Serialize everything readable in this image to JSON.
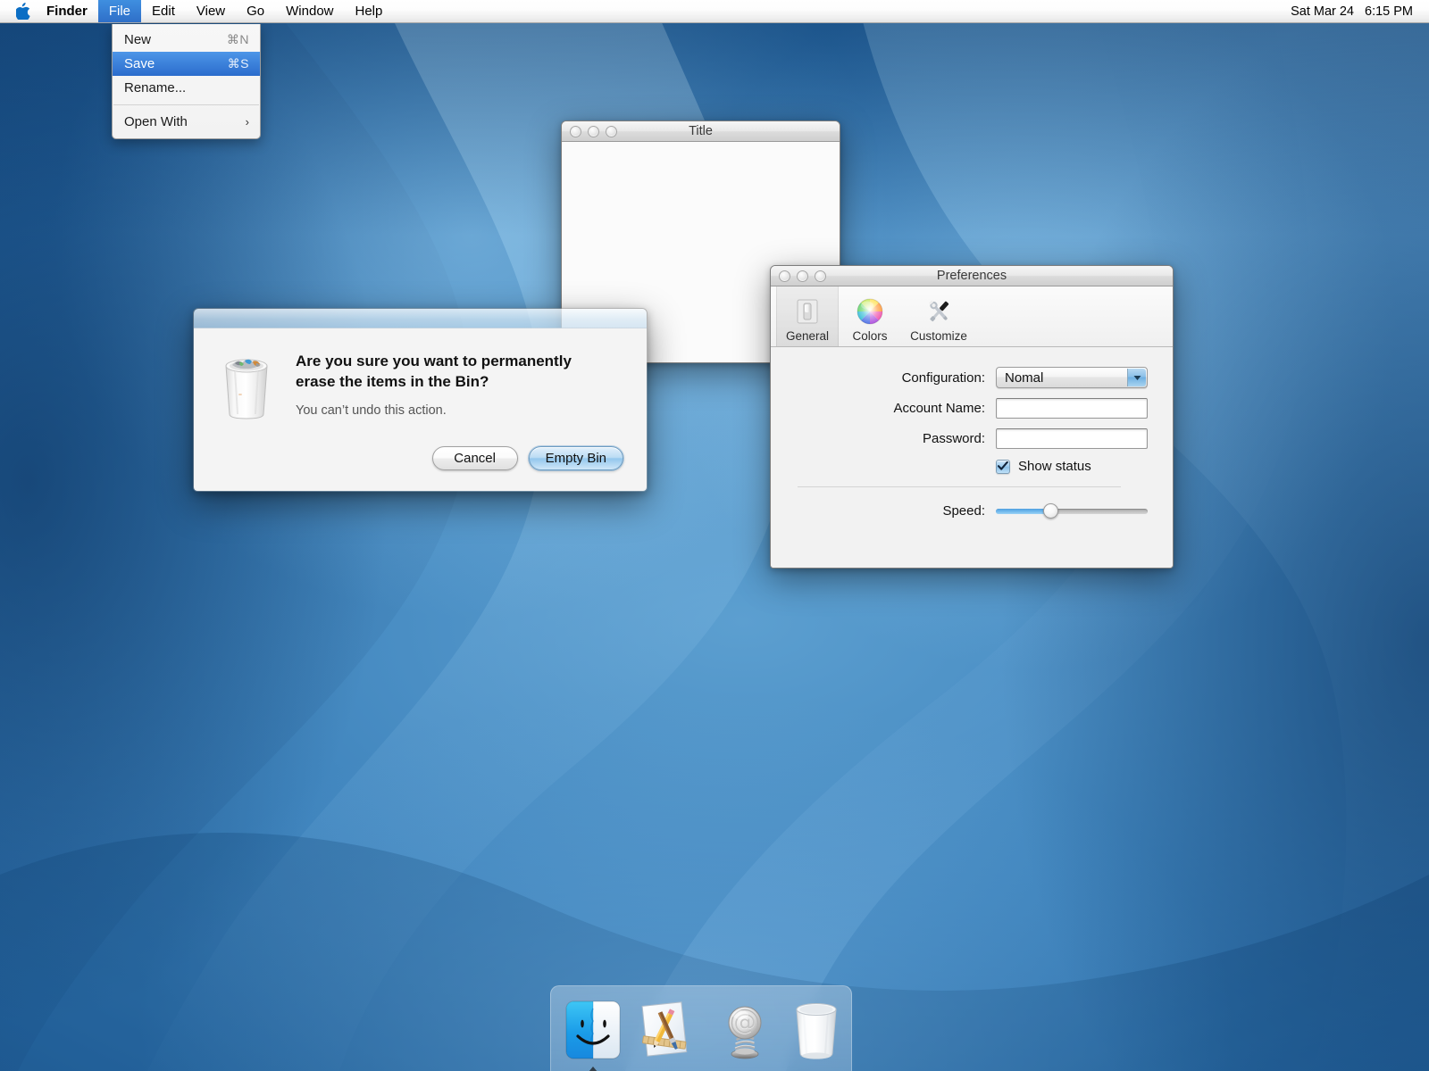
{
  "menubar": {
    "apple_icon": "apple-logo-icon",
    "items": [
      {
        "label": "Finder",
        "bold": true,
        "active": false
      },
      {
        "label": "File",
        "bold": false,
        "active": true
      },
      {
        "label": "Edit",
        "bold": false,
        "active": false
      },
      {
        "label": "View",
        "bold": false,
        "active": false
      },
      {
        "label": "Go",
        "bold": false,
        "active": false
      },
      {
        "label": "Window",
        "bold": false,
        "active": false
      },
      {
        "label": "Help",
        "bold": false,
        "active": false
      }
    ],
    "clock_date": "Sat Mar 24",
    "clock_time": "6:15 PM",
    "highlight_color": "#2f6fc8"
  },
  "file_menu": {
    "rows": [
      {
        "label": "New",
        "shortcut": "⌘N",
        "highlighted": false
      },
      {
        "label": "Save",
        "shortcut": "⌘S",
        "highlighted": true
      },
      {
        "label": "Rename...",
        "shortcut": "",
        "highlighted": false
      }
    ],
    "submenu_row": {
      "label": "Open With",
      "arrow": "›"
    }
  },
  "title_window": {
    "title": "Title",
    "traffic_lights": [
      "close-button",
      "minimize-button",
      "zoom-button"
    ]
  },
  "preferences": {
    "title": "Preferences",
    "traffic_lights": [
      "close-button",
      "minimize-button",
      "zoom-button"
    ],
    "toolbar": [
      {
        "label": "General",
        "icon": "light-switch-icon",
        "selected": true
      },
      {
        "label": "Colors",
        "icon": "color-wheel-icon",
        "selected": false
      },
      {
        "label": "Customize",
        "icon": "tools-icon",
        "selected": false
      }
    ],
    "fields": {
      "configuration_label": "Configuration:",
      "configuration_value": "Nomal",
      "account_label": "Account Name:",
      "account_value": "",
      "password_label": "Password:",
      "password_value": "",
      "show_status_label": "Show status",
      "show_status_checked": true,
      "speed_label": "Speed:",
      "speed_percent": 36
    },
    "accent_color": "#74bbee"
  },
  "alert": {
    "icon": "trash-full-icon",
    "heading": "Are you sure you want to permanently erase the items in the Bin?",
    "subtext": "You can’t undo this action.",
    "cancel_label": "Cancel",
    "confirm_label": "Empty Bin",
    "default_button": "Empty Bin"
  },
  "dock": {
    "apps": [
      {
        "name": "Finder",
        "icon": "finder-icon",
        "running": true
      },
      {
        "name": "TextEdit",
        "icon": "textedit-icon",
        "running": false
      }
    ],
    "others": [
      {
        "name": "Mail",
        "icon": "mail-stamp-icon",
        "running": false
      },
      {
        "name": "Trash",
        "icon": "trash-empty-icon",
        "running": false
      }
    ]
  },
  "desktop": {
    "wallpaper_colors": [
      "#5c9fd0",
      "#2a6ca8",
      "#17497c",
      "#1e5a96"
    ]
  }
}
